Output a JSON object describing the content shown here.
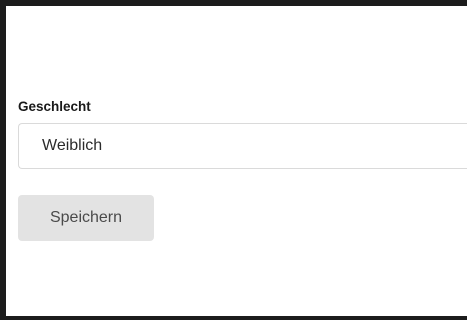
{
  "form": {
    "gender_label": "Geschlecht",
    "gender_value": "Weiblich",
    "save_label": "Speichern"
  }
}
